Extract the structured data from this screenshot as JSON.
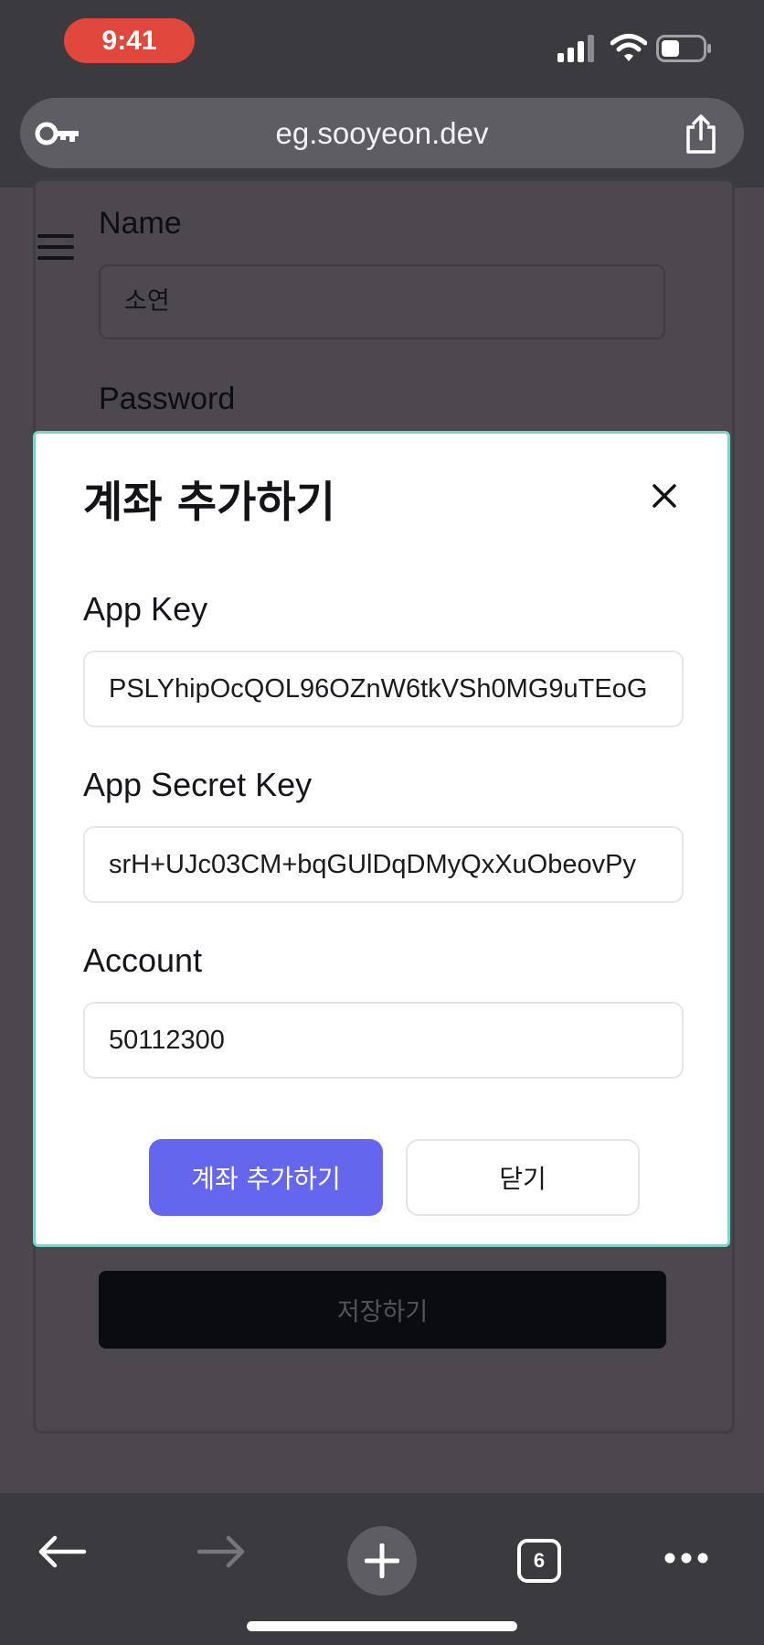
{
  "status_bar": {
    "time": "9:41"
  },
  "browser": {
    "url": "eg.sooyeon.dev",
    "tab_count": "6"
  },
  "background_form": {
    "name_label": "Name",
    "name_value": "소연",
    "password_label": "Password",
    "save_label": "저장하기"
  },
  "modal": {
    "title": "계좌 추가하기",
    "fields": [
      {
        "label": "App Key",
        "value": "PSLYhipOcQOL96OZnW6tkVSh0MG9uTEoG"
      },
      {
        "label": "App Secret Key",
        "value": "srH+UJc03CM+bqGUlDqDMyQxXuObeovPy"
      },
      {
        "label": "Account",
        "value": "50112300"
      }
    ],
    "primary_button": "계좌 추가하기",
    "secondary_button": "닫기"
  },
  "colors": {
    "accent": "#6466ee",
    "modal_border": "#7ed3c6",
    "time_pill": "#e0483d"
  }
}
